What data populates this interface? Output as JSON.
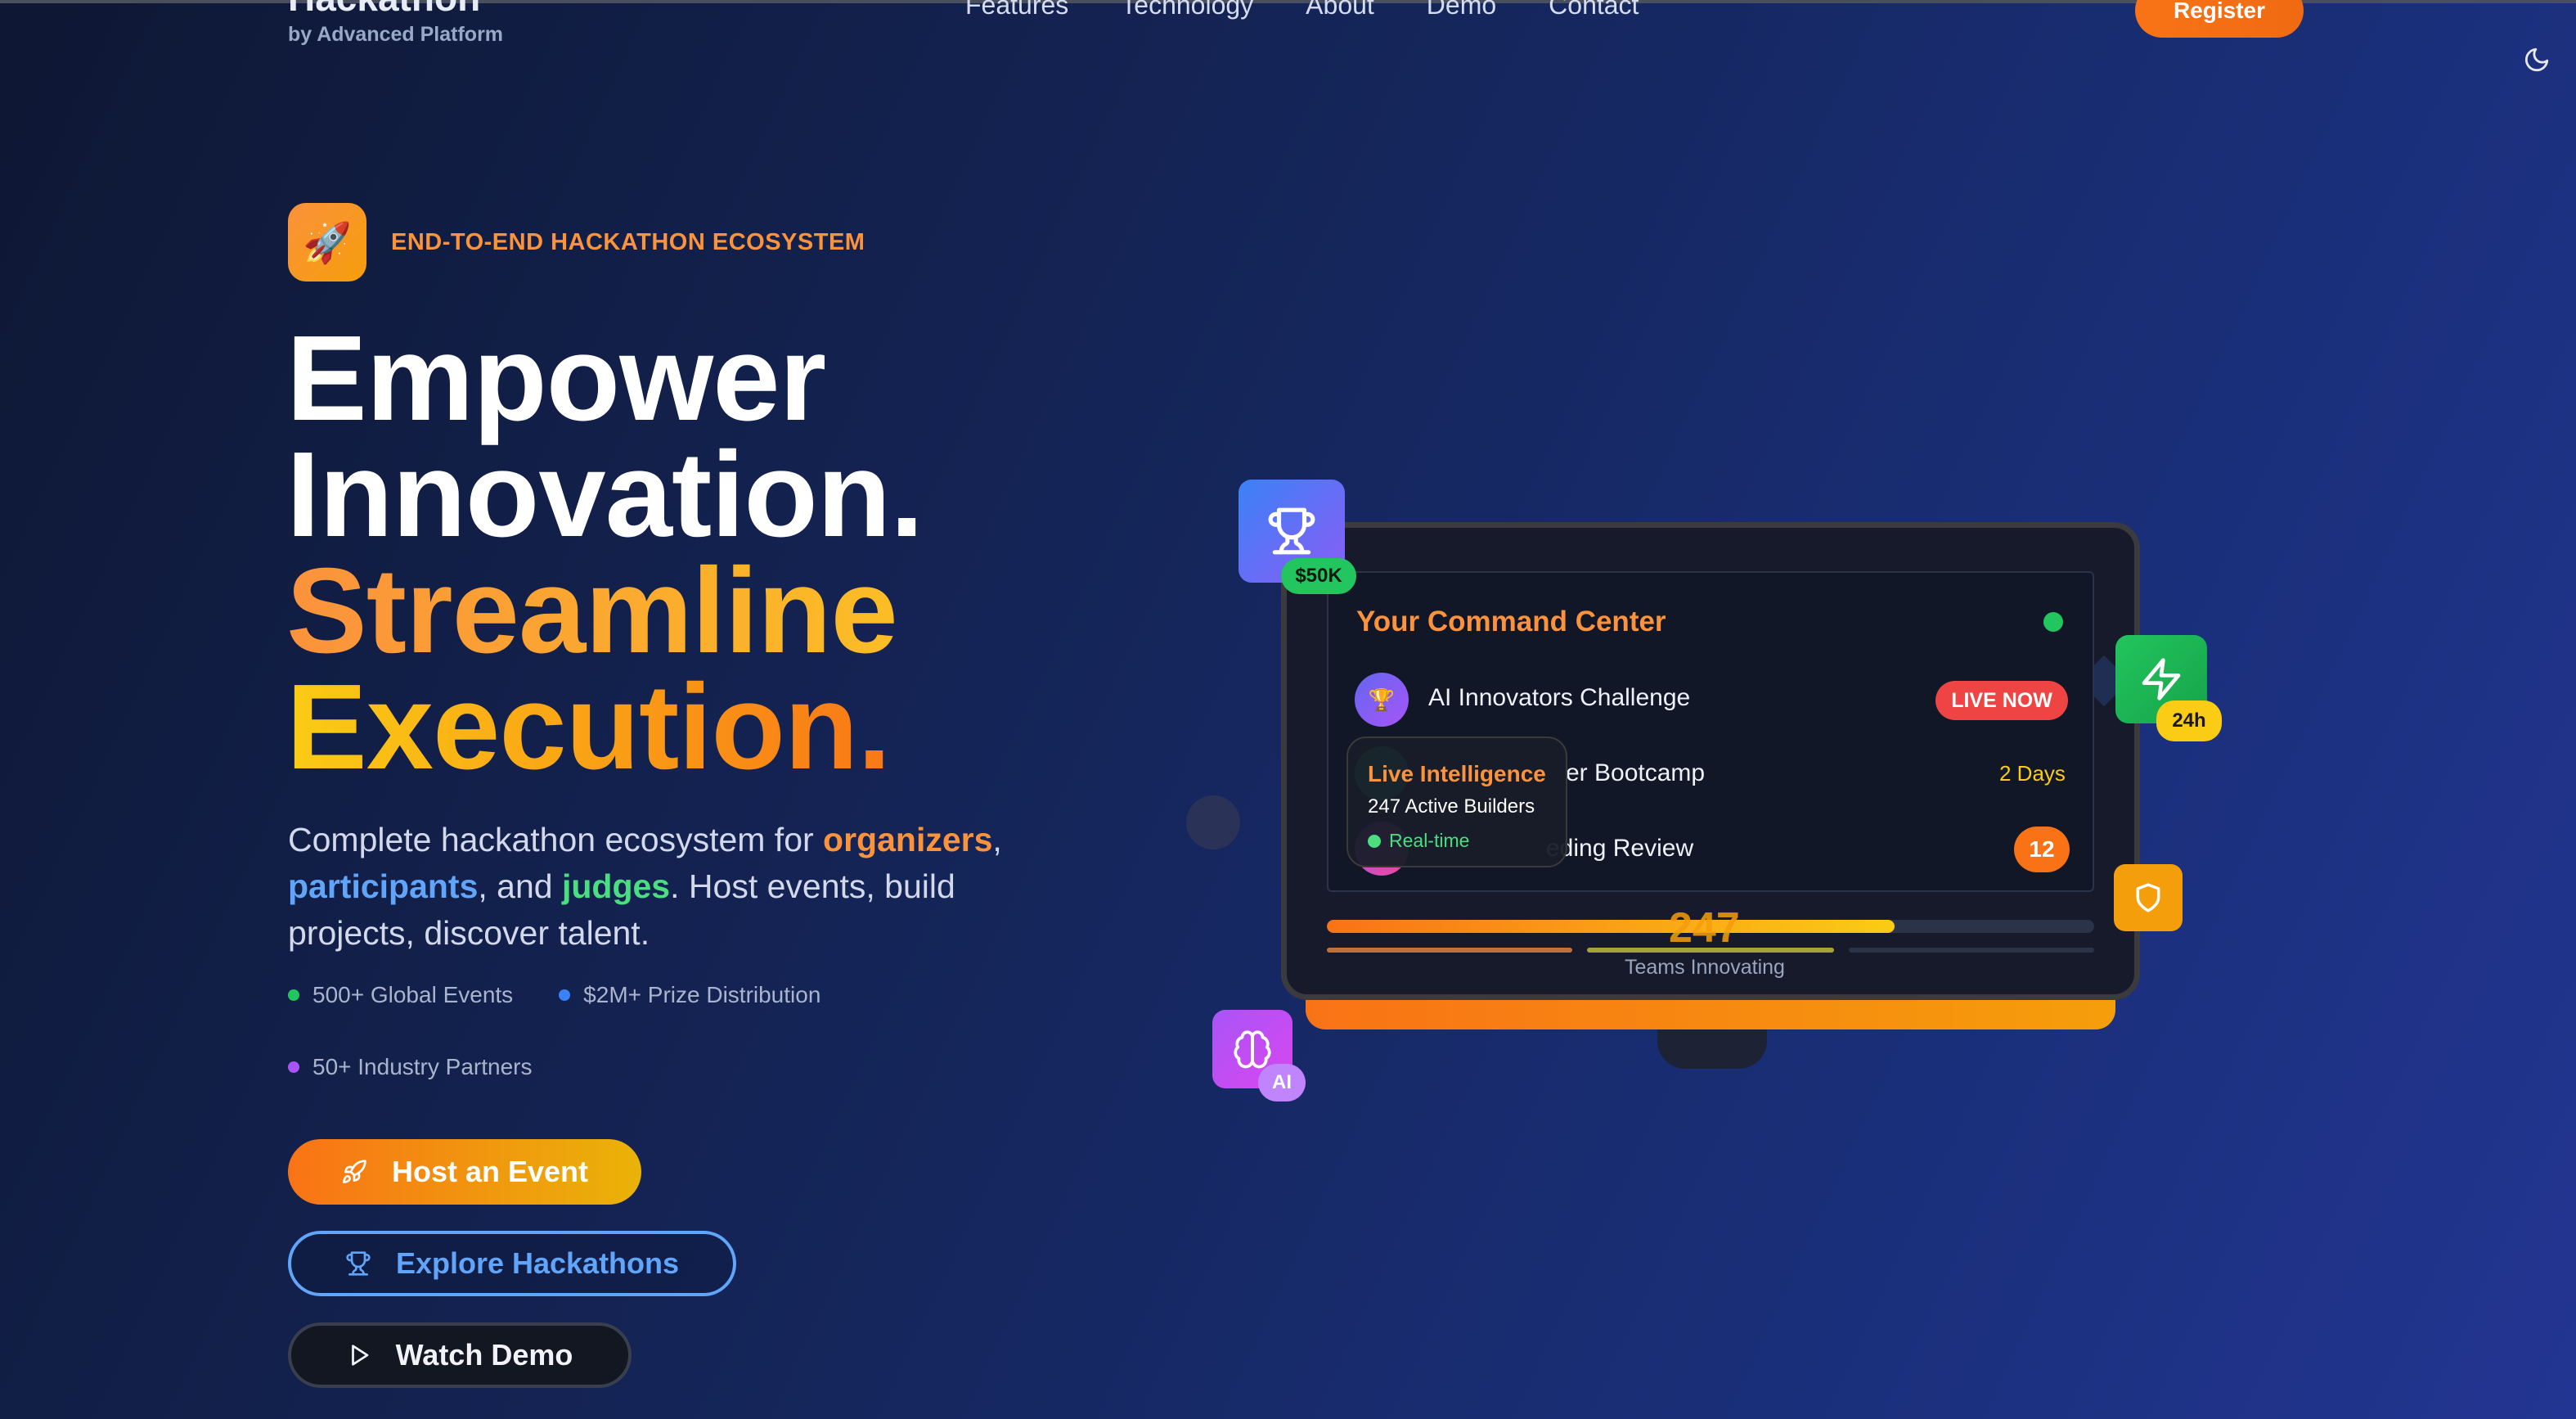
{
  "brand": {
    "title": "Hackathon",
    "subtitle": "by Advanced Platform"
  },
  "nav": {
    "links": [
      "Features",
      "Technology",
      "About",
      "Demo",
      "Contact"
    ],
    "register_label": "Register"
  },
  "hero": {
    "badge_icon": "rocket-icon",
    "badge_text": "END-TO-END HACKATHON ECOSYSTEM",
    "headline": [
      "Empower",
      "Innovation.",
      "Streamline",
      "Execution."
    ],
    "lead": {
      "part1": "Complete hackathon ecosystem for ",
      "organizers": "organizers",
      "comma1": ",",
      "participants": "participants",
      "part2": ", and ",
      "judges": "judges",
      "part3": ". Host events, build projects, discover talent."
    },
    "stats": [
      {
        "label": "500+ Global Events",
        "color": "#22c55e"
      },
      {
        "label": "$2M+ Prize Distribution",
        "color": "#3b82f6"
      },
      {
        "label": "50+ Industry Partners",
        "color": "#a855f7"
      }
    ],
    "buttons": {
      "host": "Host an Event",
      "explore": "Explore Hackathons",
      "demo": "Watch Demo"
    }
  },
  "dashboard": {
    "title": "Your Command Center",
    "rows": [
      {
        "name": "AI Innovators Challenge",
        "status": "LIVE NOW"
      },
      {
        "name": "er Bootcamp",
        "status": "2 Days"
      },
      {
        "name": "eding Review",
        "status": "12"
      }
    ],
    "tooltip": {
      "title": "Live Intelligence",
      "subtitle": "247 Active Builders",
      "status": "Real-time"
    },
    "progress": 0.74,
    "big_number": "247",
    "teams_label": "Teams Innovating"
  },
  "floating": {
    "prize_tag": "$50K",
    "time_tag": "24h",
    "ai_tag": "AI"
  },
  "colors": {
    "accent_orange": "#f97316",
    "accent_yellow": "#facc15",
    "accent_blue": "#60a5fa",
    "accent_green": "#4ade80"
  }
}
